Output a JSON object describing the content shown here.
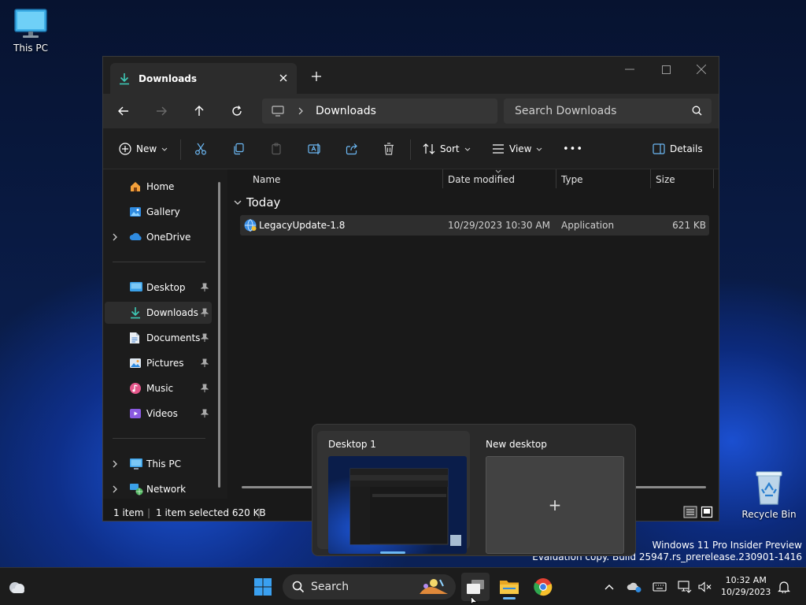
{
  "desktop": {
    "this_pc_label": "This PC",
    "recycle_bin_label": "Recycle Bin",
    "watermark_line1": "Windows 11 Pro Insider Preview",
    "watermark_line2": "Evaluation copy. Build 25947.rs_prerelease.230901-1416"
  },
  "window": {
    "tab_title": "Downloads",
    "address_crumb": "Downloads",
    "search_placeholder": "Search Downloads"
  },
  "toolbar": {
    "new_label": "New",
    "sort_label": "Sort",
    "view_label": "View",
    "more_label": "•••",
    "details_label": "Details"
  },
  "sidebar": {
    "items": [
      {
        "label": "Home",
        "icon": "home-icon"
      },
      {
        "label": "Gallery",
        "icon": "gallery-icon"
      },
      {
        "label": "OneDrive",
        "icon": "onedrive-icon"
      },
      {
        "label": "Desktop",
        "icon": "desktop-folder-icon"
      },
      {
        "label": "Downloads",
        "icon": "download-icon"
      },
      {
        "label": "Documents",
        "icon": "documents-icon"
      },
      {
        "label": "Pictures",
        "icon": "pictures-icon"
      },
      {
        "label": "Music",
        "icon": "music-icon"
      },
      {
        "label": "Videos",
        "icon": "videos-icon"
      },
      {
        "label": "This PC",
        "icon": "this-pc-icon"
      },
      {
        "label": "Network",
        "icon": "network-icon"
      }
    ]
  },
  "file_list": {
    "columns": [
      "Name",
      "Date modified",
      "Type",
      "Size"
    ],
    "group": "Today",
    "rows": [
      {
        "name": "LegacyUpdate-1.8",
        "date": "10/29/2023 10:30 AM",
        "type": "Application",
        "size": "621 KB"
      }
    ]
  },
  "status": {
    "count": "1 item",
    "selection": "1 item selected  620 KB",
    "divider": "|"
  },
  "task_view": {
    "desktop1_label": "Desktop 1",
    "new_desktop_label": "New desktop",
    "plus": "+"
  },
  "taskbar": {
    "search_label": "Search",
    "time": "10:32 AM",
    "date": "10/29/2023"
  },
  "colors": {
    "accent": "#6cb8f4",
    "window_bg": "#191919"
  }
}
